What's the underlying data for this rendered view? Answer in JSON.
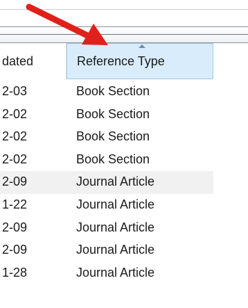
{
  "columns": {
    "updated_label": "dated",
    "reference_type_label": "Reference Type"
  },
  "rows": [
    {
      "date": "2-03",
      "type": "Book Section"
    },
    {
      "date": "2-02",
      "type": "Book Section"
    },
    {
      "date": "2-02",
      "type": "Book Section"
    },
    {
      "date": "2-02",
      "type": "Book Section"
    },
    {
      "date": "2-09",
      "type": "Journal Article"
    },
    {
      "date": "1-22",
      "type": "Journal Article"
    },
    {
      "date": "2-09",
      "type": "Journal Article"
    },
    {
      "date": "2-09",
      "type": "Journal Article"
    },
    {
      "date": "1-28",
      "type": "Journal Article"
    }
  ],
  "colors": {
    "arrow": "#e0201b",
    "header_highlight": "#d9ecfb",
    "row_highlight": "#f1f1f1"
  },
  "icons": {
    "sort": "sort-ascending-icon",
    "annotation": "red-pointer-arrow-icon"
  }
}
